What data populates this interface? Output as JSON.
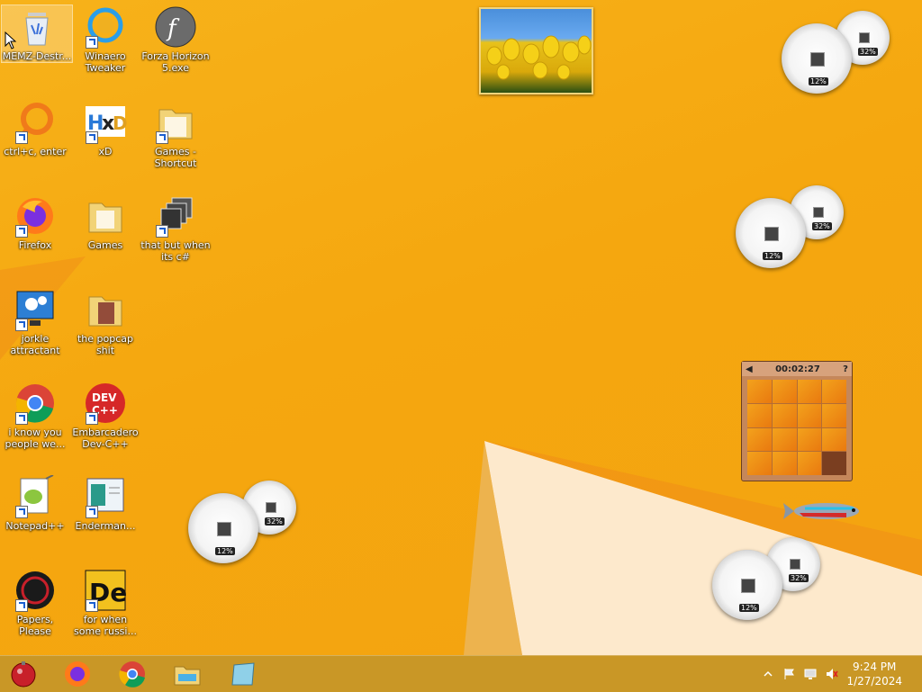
{
  "desktop": {
    "icons": [
      {
        "label": "MEMZ-Destr...",
        "icon": "recycle-bin-icon"
      },
      {
        "label": "Winaero Tweaker",
        "icon": "winaero-tweaker-icon"
      },
      {
        "label": "Forza Horizon 5.exe",
        "icon": "flash-app-icon"
      },
      {
        "label": "ctrl+c, enter",
        "icon": "magnifier-ring-icon"
      },
      {
        "label": "xD",
        "icon": "hxd-icon"
      },
      {
        "label": "Games - Shortcut",
        "icon": "folder-icon"
      },
      {
        "label": "Firefox",
        "icon": "firefox-icon"
      },
      {
        "label": "Games",
        "icon": "folder-icon"
      },
      {
        "label": "that but when its c#",
        "icon": "stacked-windows-icon"
      },
      {
        "label": "jorkle attractant",
        "icon": "settings-monitor-icon"
      },
      {
        "label": "the popcap shit",
        "icon": "folder-icon"
      },
      {
        "label": "i know you people we...",
        "icon": "chrome-icon"
      },
      {
        "label": "Embarcadero Dev-C++",
        "icon": "devcpp-icon"
      },
      {
        "label": "Notepad++",
        "icon": "notepadpp-icon"
      },
      {
        "label": "Enderman...",
        "icon": "document-window-icon"
      },
      {
        "label": "Papers, Please",
        "icon": "papers-please-icon"
      },
      {
        "label": "for when some russi...",
        "icon": "de-app-icon"
      }
    ]
  },
  "gadgets": {
    "meters": [
      {
        "cpu": "12%",
        "ram": "32%"
      },
      {
        "cpu": "12%",
        "ram": "32%"
      },
      {
        "cpu": "12%",
        "ram": "32%"
      },
      {
        "cpu": "12%",
        "ram": "32%"
      }
    ],
    "puzzle": {
      "timer": "00:02:27"
    }
  },
  "taskbar": {
    "apps": [
      "start-orb-icon",
      "firefox-icon",
      "chrome-icon",
      "file-explorer-icon",
      "notebook-icon"
    ],
    "clock": {
      "time": "9:24 PM",
      "date": "1/27/2024"
    }
  },
  "colors": {
    "wallpaper": "#f5a70f",
    "taskbar": "#c49628",
    "accent_red": "#e54a2c"
  }
}
